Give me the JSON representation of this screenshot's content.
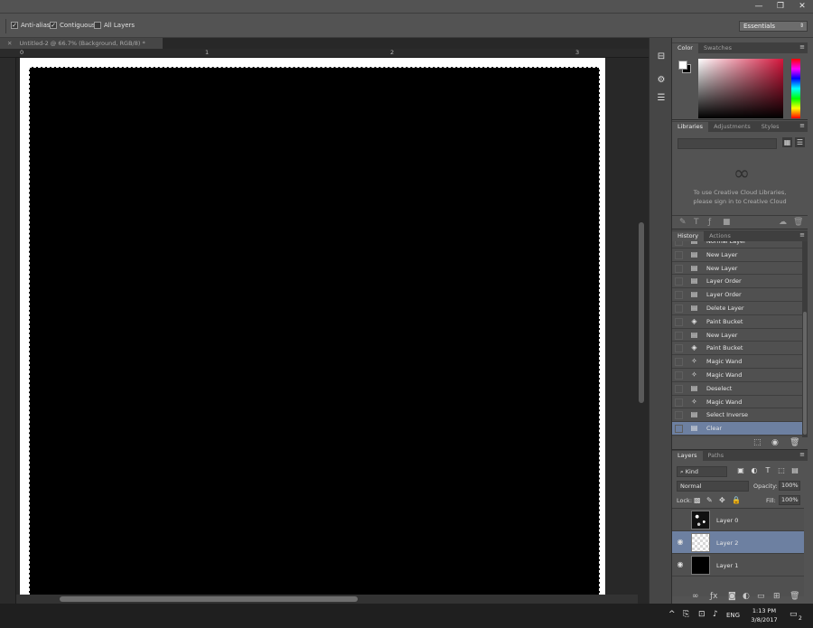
{
  "window": {
    "controls": [
      "—",
      "❐",
      "✕"
    ]
  },
  "options_bar": {
    "anti_alias": {
      "label": "Anti-alias",
      "checked": true
    },
    "contiguous": {
      "label": "Contiguous",
      "checked": true
    },
    "all_layers": {
      "label": "All Layers",
      "checked": false
    },
    "workspace": "Essentials"
  },
  "document": {
    "tab_title": "Untitled-2 @ 66.7% (Background, RGB/8) *",
    "tab_close": "✕",
    "ruler_numbers": [
      "0",
      "1",
      "2",
      "3"
    ]
  },
  "color_panel": {
    "tabs": [
      "Color",
      "Swatches"
    ],
    "foreground": "#ffffff",
    "background": "#000000"
  },
  "libraries_panel": {
    "tabs": [
      "Libraries",
      "Adjustments",
      "Styles"
    ],
    "message_line1": "To use Creative Cloud Libraries,",
    "message_line2": "please sign in to Creative Cloud"
  },
  "history_panel": {
    "tabs": [
      "History",
      "Actions"
    ],
    "items": [
      {
        "label": "Normal Layer",
        "icon": "document-icon"
      },
      {
        "label": "New Layer",
        "icon": "document-icon"
      },
      {
        "label": "New Layer",
        "icon": "document-icon"
      },
      {
        "label": "Layer Order",
        "icon": "document-icon"
      },
      {
        "label": "Layer Order",
        "icon": "document-icon"
      },
      {
        "label": "Delete Layer",
        "icon": "document-icon"
      },
      {
        "label": "Paint Bucket",
        "icon": "paint-bucket-icon"
      },
      {
        "label": "New Layer",
        "icon": "document-icon"
      },
      {
        "label": "Paint Bucket",
        "icon": "paint-bucket-icon"
      },
      {
        "label": "Magic Wand",
        "icon": "magic-wand-icon"
      },
      {
        "label": "Magic Wand",
        "icon": "magic-wand-icon"
      },
      {
        "label": "Deselect",
        "icon": "document-icon"
      },
      {
        "label": "Magic Wand",
        "icon": "magic-wand-icon"
      },
      {
        "label": "Select Inverse",
        "icon": "document-icon"
      },
      {
        "label": "Clear",
        "icon": "document-icon",
        "active": true
      }
    ]
  },
  "layers_panel": {
    "tabs": [
      "Layers",
      "Paths"
    ],
    "filter_kind": "Kind",
    "blend_mode": "Normal",
    "opacity_label": "Opacity:",
    "opacity_value": "100%",
    "lock_label": "Lock:",
    "fill_label": "Fill:",
    "fill_value": "100%",
    "layers": [
      {
        "name": "Layer 0",
        "visible": false,
        "thumb": "noise"
      },
      {
        "name": "Layer 2",
        "visible": true,
        "thumb": "transparent",
        "active": true
      },
      {
        "name": "Layer 1",
        "visible": true,
        "thumb": "black"
      }
    ]
  },
  "taskbar": {
    "time": "1:13 PM",
    "date": "3/8/2017",
    "language": "ENG",
    "notifications": "2"
  },
  "colors": {
    "selection": "#6d80a1",
    "panel_bg": "#535353",
    "canvas_bg": "#282828"
  }
}
